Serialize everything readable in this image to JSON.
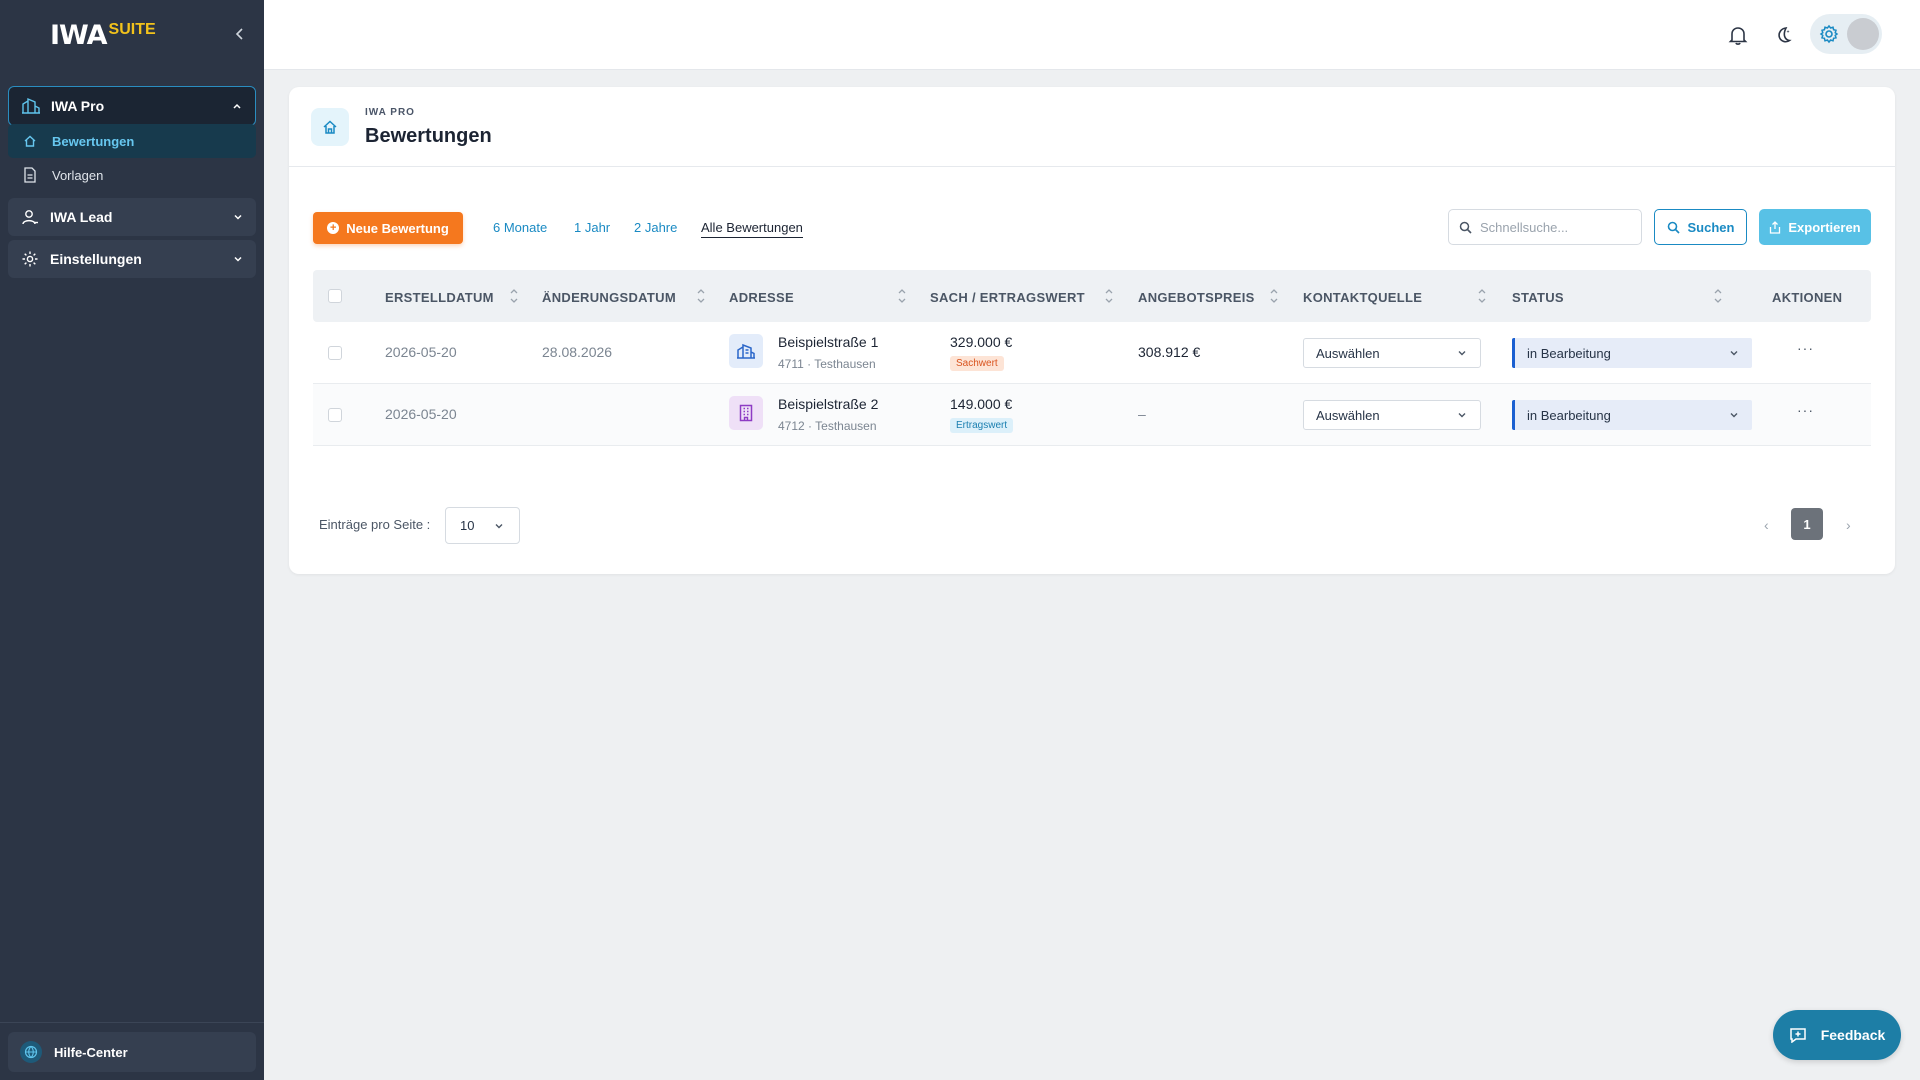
{
  "sidebar": {
    "logo_main": "IWA",
    "logo_suffix": "SUITE",
    "groups": [
      {
        "label": "IWA Pro",
        "icon": "building-chart-icon",
        "expanded": true,
        "items": [
          {
            "label": "Bewertungen",
            "icon": "home-icon",
            "active": true
          },
          {
            "label": "Vorlagen",
            "icon": "document-icon",
            "active": false
          }
        ]
      },
      {
        "label": "IWA Lead",
        "icon": "user-icon",
        "expanded": false
      },
      {
        "label": "Einstellungen",
        "icon": "gear-icon",
        "expanded": false
      }
    ],
    "help_label": "Hilfe-Center"
  },
  "topbar": {
    "icons": [
      "bell-icon",
      "moon-icon",
      "gear-icon",
      "avatar"
    ]
  },
  "page": {
    "eyebrow": "IWA PRO",
    "title": "Bewertungen",
    "new_button": "Neue Bewertung",
    "filters": [
      {
        "label": "6 Monate",
        "active": false
      },
      {
        "label": "1 Jahr",
        "active": false
      },
      {
        "label": "2 Jahre",
        "active": false
      },
      {
        "label": "Alle Bewertungen",
        "active": true
      }
    ],
    "search_placeholder": "Schnellsuche...",
    "search_button": "Suchen",
    "export_button": "Exportieren"
  },
  "table": {
    "columns": [
      "ERSTELLDATUM",
      "ÄNDERUNGSDATUM",
      "ADRESSE",
      "SACH / ERTRAGSWERT",
      "ANGEBOTSPREIS",
      "KONTAKTQUELLE",
      "STATUS",
      "AKTIONEN"
    ],
    "rows": [
      {
        "created": "2026-05-20",
        "changed": "28.08.2026",
        "street": "Beispielstraße 1",
        "city": "4711 · Testhausen",
        "value": "329.000 €",
        "value_type": "Sachwert",
        "offer": "308.912 €",
        "contact": "Auswählen",
        "status": "in Bearbeitung",
        "actions": "···"
      },
      {
        "created": "2026-05-20",
        "changed": "",
        "street": "Beispielstraße 2",
        "city": "4712 · Testhausen",
        "value": "149.000 €",
        "value_type": "Ertragswert",
        "offer": "–",
        "contact": "Auswählen",
        "status": "in Bearbeitung",
        "actions": "···"
      }
    ]
  },
  "pagination": {
    "per_page_label": "Einträge pro Seite :",
    "per_page": "10",
    "prev": "‹",
    "current": "1",
    "next": "›"
  },
  "feedback_label": "Feedback",
  "colors": {
    "sidebar_bg": "#2c3545",
    "accent_blue": "#1a8ac3",
    "orange": "#f5781e",
    "sachwert_tag": "#fde4d6",
    "ertragswert_tag": "#dcf0fa",
    "status_border": "#1a5fd1"
  }
}
